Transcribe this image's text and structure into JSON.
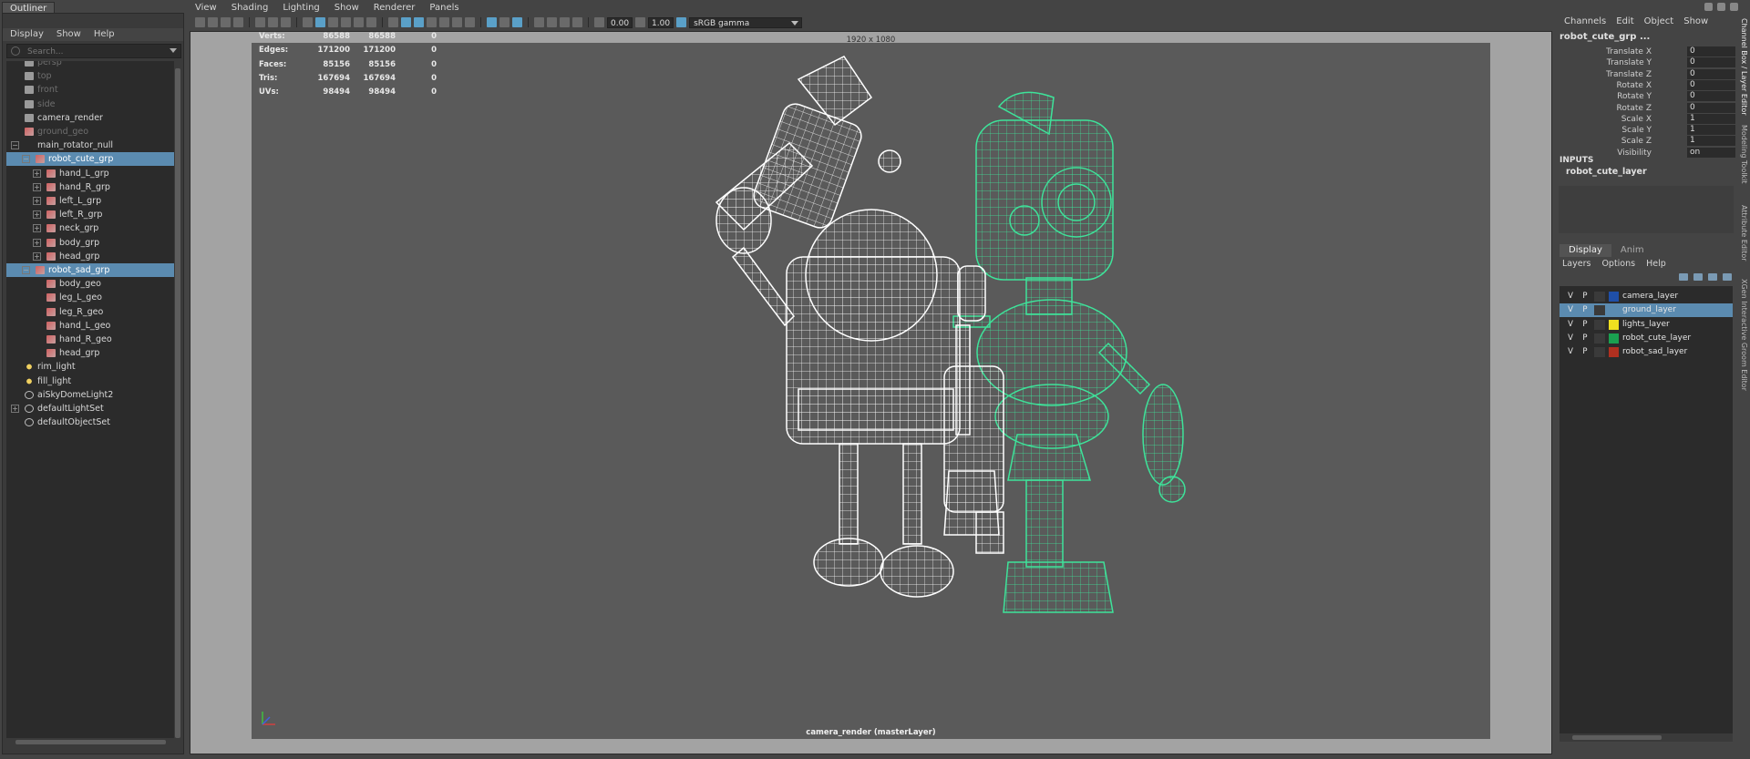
{
  "outliner": {
    "tab_label": "Outliner",
    "menu": [
      "Display",
      "Show",
      "Help"
    ],
    "search_placeholder": "Search...",
    "rows": [
      {
        "label": "persp",
        "icon": "camera-icon",
        "dim": true
      },
      {
        "label": "top",
        "icon": "camera-icon",
        "dim": true
      },
      {
        "label": "front",
        "icon": "camera-icon",
        "dim": true
      },
      {
        "label": "side",
        "icon": "camera-icon",
        "dim": true
      },
      {
        "label": "camera_render",
        "icon": "camera-icon",
        "dim": false
      },
      {
        "label": "ground_geo",
        "icon": "mesh-icon",
        "dim": true
      },
      {
        "label": "main_rotator_null",
        "icon": "null-icon",
        "dim": false,
        "expander": "−"
      },
      {
        "label": "robot_cute_grp",
        "icon": "group-mesh-icon",
        "dim": false,
        "selected": true,
        "expander": "−"
      },
      {
        "label": "hand_L_grp",
        "icon": "group-mesh-icon",
        "dim": false,
        "expander": "+"
      },
      {
        "label": "hand_R_grp",
        "icon": "group-mesh-icon",
        "dim": false,
        "expander": "+"
      },
      {
        "label": "left_L_grp",
        "icon": "group-mesh-icon",
        "dim": false,
        "expander": "+"
      },
      {
        "label": "left_R_grp",
        "icon": "group-mesh-icon",
        "dim": false,
        "expander": "+"
      },
      {
        "label": "neck_grp",
        "icon": "group-mesh-icon",
        "dim": false,
        "expander": "+"
      },
      {
        "label": "body_grp",
        "icon": "group-mesh-icon",
        "dim": false,
        "expander": "+"
      },
      {
        "label": "head_grp",
        "icon": "group-mesh-icon",
        "dim": false,
        "expander": "+"
      },
      {
        "label": "robot_sad_grp",
        "icon": "group-mesh-icon",
        "dim": false,
        "selected": true,
        "expander": "−"
      },
      {
        "label": "body_geo",
        "icon": "mesh-icon",
        "dim": false
      },
      {
        "label": "leg_L_geo",
        "icon": "mesh-icon",
        "dim": false
      },
      {
        "label": "leg_R_geo",
        "icon": "mesh-icon",
        "dim": false
      },
      {
        "label": "hand_L_geo",
        "icon": "mesh-icon",
        "dim": false
      },
      {
        "label": "hand_R_geo",
        "icon": "mesh-icon",
        "dim": false
      },
      {
        "label": "head_grp",
        "icon": "group-mesh-icon",
        "dim": false
      },
      {
        "label": "rim_light",
        "icon": "light-icon",
        "dim": false
      },
      {
        "label": "fill_light",
        "icon": "light-icon",
        "dim": false
      },
      {
        "label": "aiSkyDomeLight2",
        "icon": "skydome-icon",
        "dim": false
      },
      {
        "label": "defaultLightSet",
        "icon": "set-icon",
        "dim": false,
        "expander": "+"
      },
      {
        "label": "defaultObjectSet",
        "icon": "set-icon",
        "dim": false
      }
    ]
  },
  "viewport": {
    "menu": [
      "View",
      "Shading",
      "Lighting",
      "Show",
      "Renderer",
      "Panels"
    ],
    "exposure": "0.00",
    "gamma": "1.00",
    "color_space": "sRGB gamma",
    "resolution": "1920 x 1080",
    "camera_label": "camera_render (masterLayer)",
    "hud": [
      {
        "key": "Verts:",
        "v1": "86588",
        "v2": "86588",
        "v3": "0"
      },
      {
        "key": "Edges:",
        "v1": "171200",
        "v2": "171200",
        "v3": "0"
      },
      {
        "key": "Faces:",
        "v1": "85156",
        "v2": "85156",
        "v3": "0"
      },
      {
        "key": "Tris:",
        "v1": "167694",
        "v2": "167694",
        "v3": "0"
      },
      {
        "key": "UVs:",
        "v1": "98494",
        "v2": "98494",
        "v3": "0"
      }
    ]
  },
  "channel_box": {
    "menu": [
      "Channels",
      "Edit",
      "Object",
      "Show"
    ],
    "object_name": "robot_cute_grp ...",
    "attributes": [
      {
        "name": "Translate X",
        "value": "0"
      },
      {
        "name": "Translate Y",
        "value": "0"
      },
      {
        "name": "Translate Z",
        "value": "0"
      },
      {
        "name": "Rotate X",
        "value": "0"
      },
      {
        "name": "Rotate Y",
        "value": "0"
      },
      {
        "name": "Rotate Z",
        "value": "0"
      },
      {
        "name": "Scale X",
        "value": "1"
      },
      {
        "name": "Scale Y",
        "value": "1"
      },
      {
        "name": "Scale Z",
        "value": "1"
      },
      {
        "name": "Visibility",
        "value": "on"
      }
    ],
    "inputs_label": "INPUTS",
    "input_item": "robot_cute_layer",
    "side_tabs": [
      "Channel Box / Layer Editor",
      "Modeling Toolkit",
      "Attribute Editor",
      "XGen Interactive Groom Editor"
    ]
  },
  "layer_editor": {
    "tabs": [
      "Display",
      "Anim"
    ],
    "menu": [
      "Layers",
      "Options",
      "Help"
    ],
    "layers": [
      {
        "name": "camera_layer",
        "color": "#1f4fa8",
        "selected": false
      },
      {
        "name": "ground_layer",
        "color": "#5b8bb0",
        "selected": true
      },
      {
        "name": "lights_layer",
        "color": "#f0e020",
        "selected": false
      },
      {
        "name": "robot_cute_layer",
        "color": "#1aa050",
        "selected": false
      },
      {
        "name": "robot_sad_layer",
        "color": "#b03020",
        "selected": false
      }
    ],
    "v_label": "V",
    "p_label": "P"
  },
  "colors": {
    "selection": "#5b8bb0",
    "cute_wire": "#3ee39a",
    "sad_wire": "#ffffff"
  }
}
